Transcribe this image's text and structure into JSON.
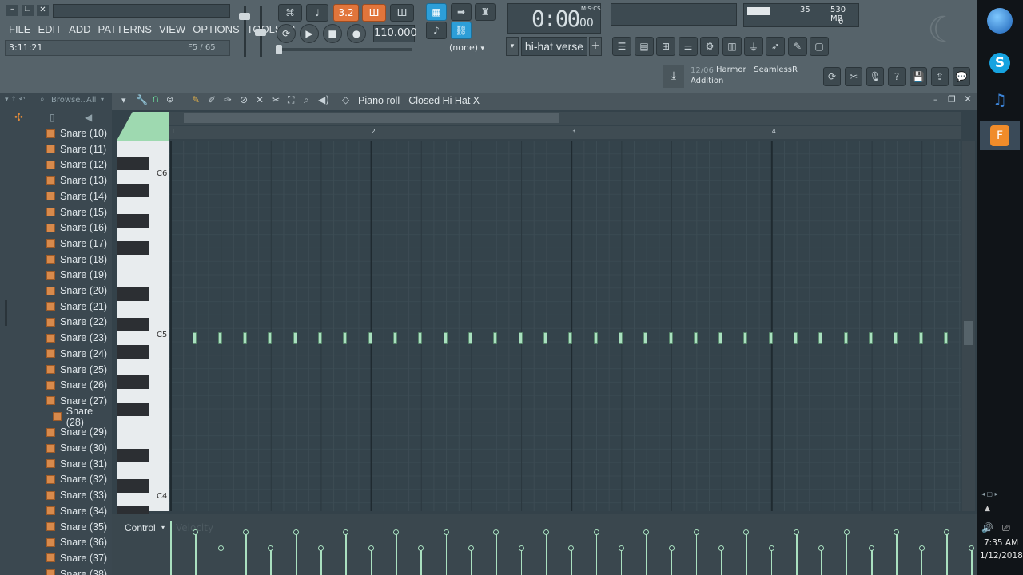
{
  "menu": [
    "FILE",
    "EDIT",
    "ADD",
    "PATTERNS",
    "VIEW",
    "OPTIONS",
    "TOOLS",
    "?"
  ],
  "song_position": "3:11:21",
  "hint_panel": "F5 / 65",
  "pattern_mode": "3.2",
  "tempo": "110.000",
  "time_display": "0:00",
  "time_display_small": "00",
  "time_format_label": "M:S:CS",
  "snap": "(none)",
  "pattern_name": "hi-hat verse",
  "cpu": "35",
  "memory": "530 MB",
  "polyphony": "0",
  "news": {
    "date": "12/06",
    "title": "Harmor | SeamlessR",
    "subtitle": "Addition"
  },
  "browser": {
    "label": "Browse..",
    "filter": "All",
    "items": [
      "Snare (10)",
      "Snare (11)",
      "Snare (12)",
      "Snare (13)",
      "Snare (14)",
      "Snare (15)",
      "Snare (16)",
      "Snare (17)",
      "Snare (18)",
      "Snare (19)",
      "Snare (20)",
      "Snare (21)",
      "Snare (22)",
      "Snare (23)",
      "Snare (24)",
      "Snare (25)",
      "Snare (26)",
      "Snare (27)",
      "Snare (28)",
      "Snare (29)",
      "Snare (30)",
      "Snare (31)",
      "Snare (32)",
      "Snare (33)",
      "Snare (34)",
      "Snare (35)",
      "Snare (36)",
      "Snare (37)",
      "Snare (38)"
    ],
    "selected": "Snare (28)"
  },
  "piano_roll": {
    "title": "Piano roll - Closed Hi Hat X",
    "bars": [
      "1",
      "2",
      "3",
      "4"
    ],
    "key_labels": {
      "c6": "C6",
      "c5": "C5",
      "c4": "C4"
    },
    "note_count": 32,
    "velocity_pattern": [
      1,
      0,
      1,
      0,
      1,
      0,
      1,
      0,
      1,
      0,
      1,
      0,
      1,
      0,
      1,
      0,
      1,
      0,
      1,
      0,
      1,
      0,
      1,
      0,
      1,
      0,
      1,
      0,
      1,
      0,
      1,
      0
    ],
    "control_label": "Control",
    "control_target": "Velocity"
  },
  "clock": {
    "time": "7:35 AM",
    "date": "1/12/2018"
  },
  "icons": [
    "minimize-icon",
    "restore-icon",
    "close-icon",
    "play-icon",
    "stop-icon",
    "record-icon",
    "loop-icon",
    "metronome-icon",
    "pencil-icon",
    "paint-icon",
    "delete-icon",
    "mute-icon",
    "slice-icon",
    "select-icon",
    "zoom-icon",
    "speaker-icon",
    "magnet-icon",
    "windows-start-icon",
    "skype-icon",
    "fl-studio-icon"
  ]
}
